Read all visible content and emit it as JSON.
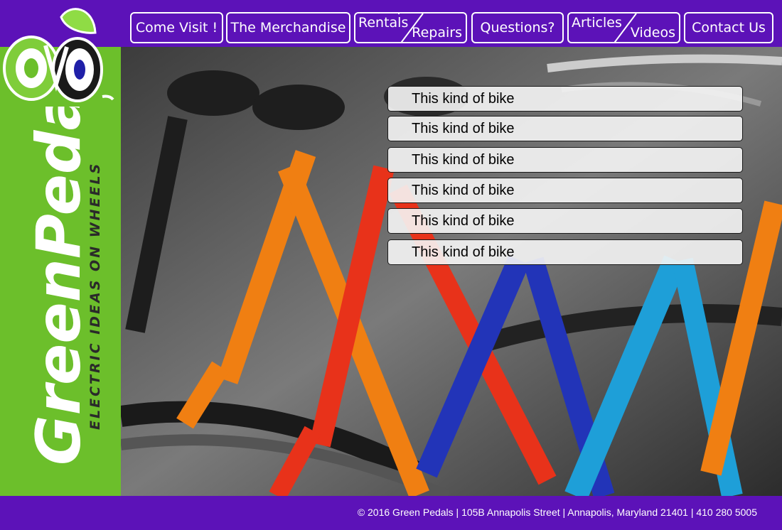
{
  "brand": {
    "name": "GreenPedals",
    "tagline": "ELECTRIC IDEAS ON WHEELS"
  },
  "nav": {
    "come_visit": "Come Visit !",
    "merchandise": "The Merchandise",
    "rentals": "Rentals",
    "repairs": "Repairs",
    "questions": "Questions?",
    "articles": "Articles",
    "videos": "Videos",
    "contact": "Contact Us"
  },
  "panels": [
    "This kind of bike",
    "This kind of bike",
    "This kind of bike",
    "This kind of bike",
    "This kind of bike",
    "This kind of bike"
  ],
  "footer": {
    "text": "© 2016 Green Pedals | 105B Annapolis Street | Annapolis, Maryland 21401 | 410 280 5005"
  },
  "colors": {
    "purple": "#5c12b8",
    "green": "#6cbf2b",
    "white": "#ffffff"
  },
  "icons": {
    "logo": "bike-wheel-logo",
    "hero": "bicycles-photo"
  }
}
